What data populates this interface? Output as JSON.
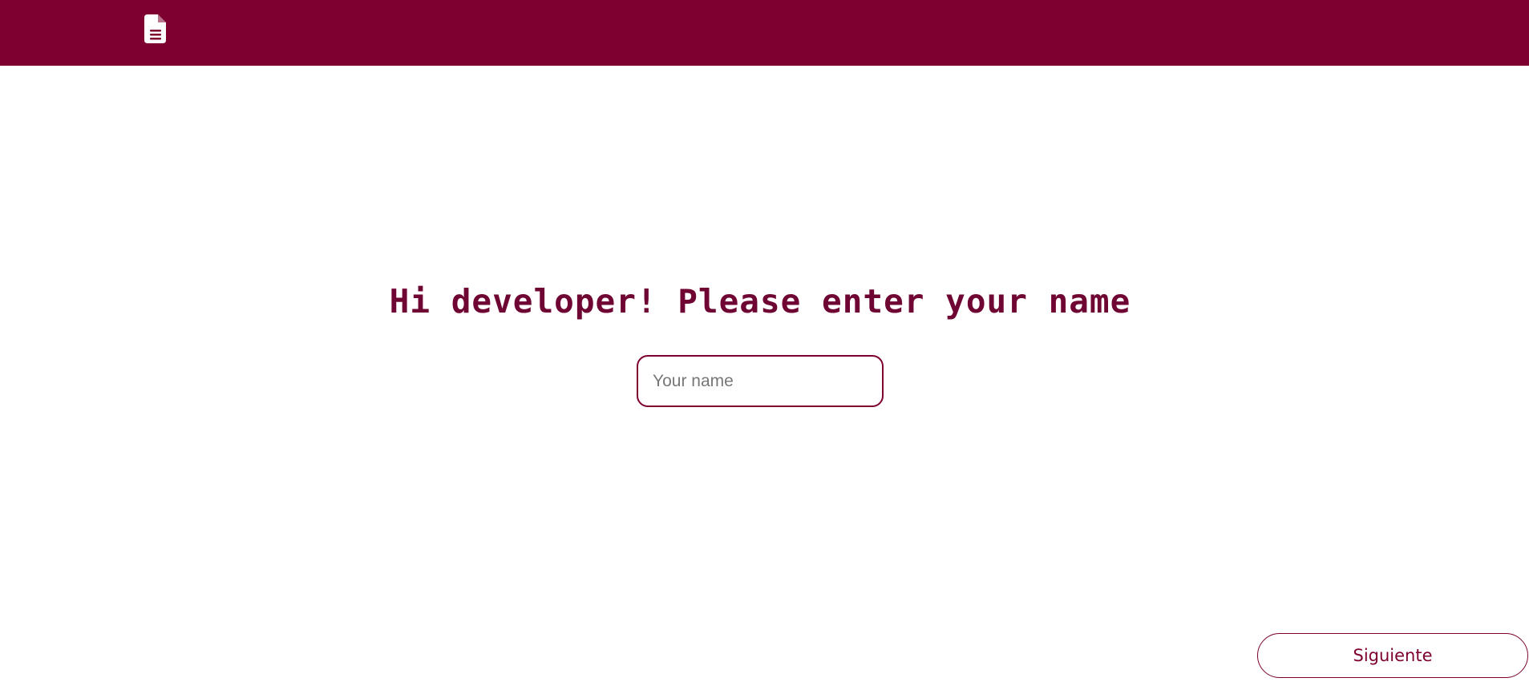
{
  "header": {
    "logo_icon": "document-icon",
    "background_color": "#7d0030"
  },
  "main": {
    "heading": "Hi developer! Please enter your name",
    "name_input": {
      "value": "",
      "placeholder": "Your name"
    },
    "next_button_label": "Siguiente",
    "accent_color": "#7d0030"
  }
}
